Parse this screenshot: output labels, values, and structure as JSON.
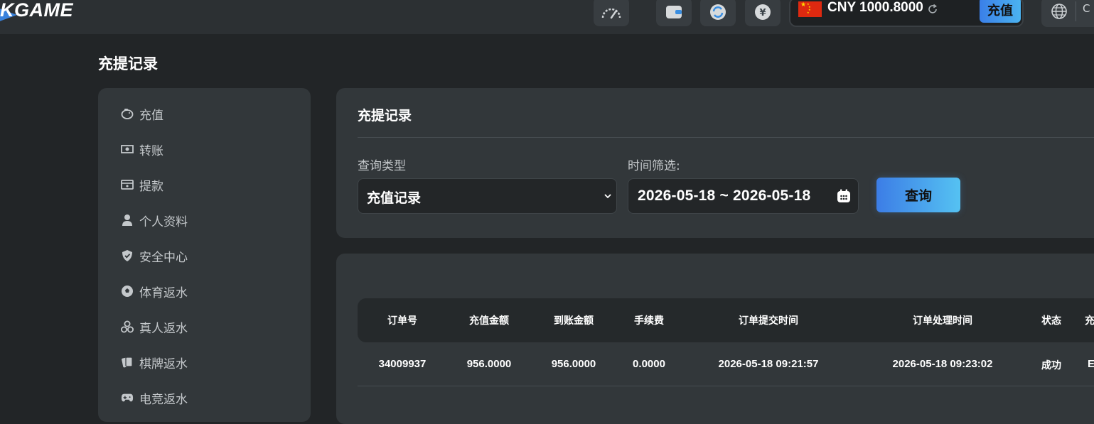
{
  "header": {
    "logo_text": "KGAME",
    "icons": [
      "speed-icon",
      "wallet-icon",
      "transfer-icon",
      "yuan-icon"
    ],
    "balance": {
      "currency_flag": "china-flag",
      "amount_text": "CNY 1000.8000",
      "deposit_label": "充值"
    },
    "language_code": "C"
  },
  "page": {
    "title": "充提记录"
  },
  "sidebar": {
    "items": [
      {
        "label": "充值",
        "icon": "piggy-bank-icon"
      },
      {
        "label": "转账",
        "icon": "money-icon"
      },
      {
        "label": "提款",
        "icon": "atm-icon"
      },
      {
        "label": "个人资料",
        "icon": "user-icon"
      },
      {
        "label": "安全中心",
        "icon": "shield-icon"
      },
      {
        "label": "体育返水",
        "icon": "soccer-ball-icon"
      },
      {
        "label": "真人返水",
        "icon": "chips-icon"
      },
      {
        "label": "棋牌返水",
        "icon": "cards-icon"
      },
      {
        "label": "电竞返水",
        "icon": "gamepad-icon"
      }
    ]
  },
  "filter": {
    "title": "充提记录",
    "type_label": "查询类型",
    "type_value": "充值记录",
    "time_label": "时间筛选:",
    "date_range": "2026-05-18 ~ 2026-05-18",
    "query_label": "查询"
  },
  "table": {
    "headers": [
      "订单号",
      "充值金额",
      "到账金额",
      "手续费",
      "订单提交时间",
      "订单处理时间",
      "状态",
      "充"
    ],
    "rows": [
      [
        "34009937",
        "956.0000",
        "956.0000",
        "0.0000",
        "2026-05-18 09:21:57",
        "2026-05-18 09:23:02",
        "成功",
        "E"
      ]
    ]
  },
  "colors": {
    "background": "#222527",
    "card": "#32373a",
    "accent_gradient_start": "#3c7de6",
    "accent_gradient_end": "#55c2f2"
  }
}
